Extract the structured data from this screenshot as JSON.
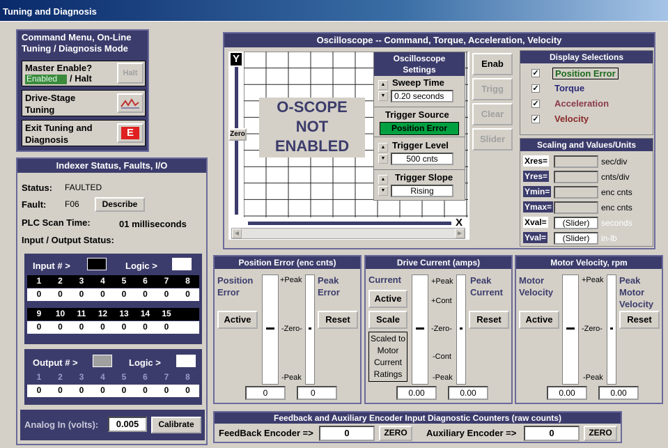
{
  "window": {
    "title": "Tuning and Diagnosis"
  },
  "command_menu": {
    "title": "Command Menu, On-Line Tuning / Diagnosis Mode",
    "master_enable_label": "Master Enable?",
    "master_enable_state": "Enabled",
    "master_enable_halt": "/ Halt",
    "halt_button": "Halt",
    "drive_stage_label": "Drive-Stage Tuning",
    "exit_label": "Exit Tuning and Diagnosis",
    "exit_icon_letter": "E"
  },
  "indexer": {
    "title": "Indexer Status, Faults, I/O",
    "status_label": "Status:",
    "status_value": "FAULTED",
    "fault_label": "Fault:",
    "fault_value": "F06",
    "describe_button": "Describe",
    "plc_label": "PLC Scan Time:",
    "plc_value": "01 milliseconds",
    "io_label": "Input / Output Status:",
    "input_header": "Input # >",
    "logic_label": "Logic >",
    "input_numbers_row1": [
      "1",
      "2",
      "3",
      "4",
      "5",
      "6",
      "7",
      "8"
    ],
    "input_values_row1": [
      "0",
      "0",
      "0",
      "0",
      "0",
      "0",
      "0",
      "0"
    ],
    "input_numbers_row2": [
      "9",
      "10",
      "11",
      "12",
      "13",
      "14",
      "15"
    ],
    "input_values_row2": [
      "0",
      "0",
      "0",
      "0",
      "0",
      "0",
      "0"
    ],
    "output_header": "Output # >",
    "output_numbers": [
      "1",
      "2",
      "3",
      "4",
      "5",
      "6",
      "7",
      "8"
    ],
    "output_values": [
      "0",
      "0",
      "0",
      "0",
      "0",
      "0",
      "0",
      "0"
    ],
    "analog_label": "Analog In (volts):",
    "analog_value": "0.005",
    "calibrate_button": "Calibrate"
  },
  "oscilloscope": {
    "title": "Oscilloscope -- Command, Torque, Acceleration, Velocity",
    "y_label": "Y",
    "x_label": "X",
    "zero_label": "Zero",
    "not_enabled": [
      "O-SCOPE",
      "NOT",
      "ENABLED"
    ],
    "settings_title": "Oscilloscope Settings",
    "sweep_time_label": "Sweep Time",
    "sweep_time_value": "0.20 seconds",
    "trigger_source_label": "Trigger Source",
    "trigger_source_value": "Position Error",
    "trigger_level_label": "Trigger Level",
    "trigger_level_value": "500 cnts",
    "trigger_slope_label": "Trigger Slope",
    "trigger_slope_value": "Rising",
    "buttons": {
      "enab": "Enab",
      "trigg": "Trigg",
      "clear": "Clear",
      "slider": "Slider"
    }
  },
  "display_selections": {
    "title": "Display Selections",
    "items": [
      {
        "label": "Position Error",
        "checked": true,
        "color": "#1a6a1a"
      },
      {
        "label": "Torque",
        "checked": true,
        "color": "#2a2a7a"
      },
      {
        "label": "Acceleration",
        "checked": true,
        "color": "#8a3a4a"
      },
      {
        "label": "Velocity",
        "checked": true,
        "color": "#8a2a2a"
      }
    ]
  },
  "scaling": {
    "title": "Scaling and Values/Units",
    "rows": [
      {
        "name": "Xres=",
        "value": "",
        "unit": "sec/div"
      },
      {
        "name": "Yres=",
        "value": "",
        "unit": "cnts/div"
      },
      {
        "name": "Ymin=",
        "value": "",
        "unit": "enc cnts"
      },
      {
        "name": "Ymax=",
        "value": "",
        "unit": "enc cnts"
      },
      {
        "name": "Xval=",
        "value": "(Slider)",
        "unit": "seconds"
      },
      {
        "name": "Yval=",
        "value": "(Slider)",
        "unit": "in-lb"
      }
    ]
  },
  "position_error": {
    "title": "Position Error (enc cnts)",
    "left_label": "Position Error",
    "right_label": "Peak Error",
    "active_button": "Active",
    "reset_button": "Reset",
    "peak_plus": "+Peak",
    "zero": "-Zero-",
    "peak_minus": "-Peak",
    "value_left": "0",
    "value_right": "0"
  },
  "drive_current": {
    "title": "Drive Current (amps)",
    "left_label": "Current",
    "right_label": "Peak Current",
    "active_button": "Active",
    "scale_button": "Scale",
    "reset_button": "Reset",
    "scaled_note": "Scaled to Motor Current Ratings",
    "peak_plus": "+Peak",
    "cont_plus": "+Cont",
    "zero": "-Zero-",
    "cont_minus": "-Cont",
    "peak_minus": "-Peak",
    "value_left": "0.00",
    "value_right": "0.00"
  },
  "motor_velocity": {
    "title": "Motor Velocity, rpm",
    "left_label": "Motor Velocity",
    "right_label": "Peak Motor Velocity",
    "active_button": "Active",
    "reset_button": "Reset",
    "peak_plus": "+Peak",
    "zero": "-Zero-",
    "peak_minus": "-Peak",
    "value_left": "0.00",
    "value_right": "0.00"
  },
  "feedback": {
    "title": "Feedback and Auxiliary Encoder Input Diagnostic Counters (raw counts)",
    "feedback_label": "FeedBack Encoder =>",
    "feedback_value": "0",
    "aux_label": "Auxiliary Encoder =>",
    "aux_value": "0",
    "zero_button": "ZERO"
  }
}
